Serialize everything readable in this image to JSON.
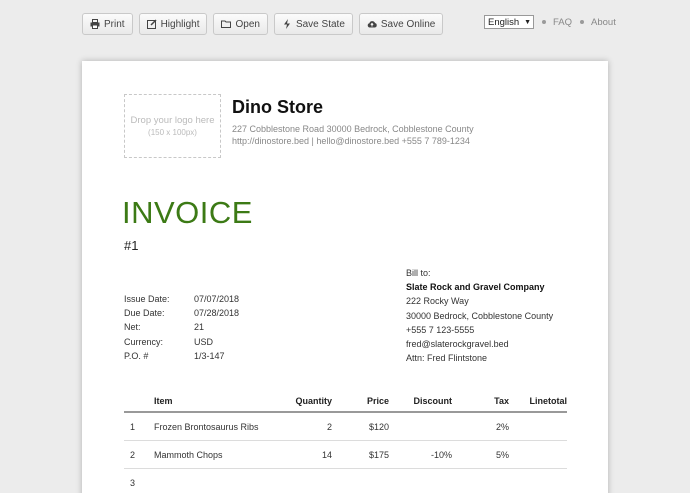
{
  "toolbar": {
    "print": "Print",
    "highlight": "Highlight",
    "open": "Open",
    "save_state": "Save State",
    "save_online": "Save Online"
  },
  "nav": {
    "language": "English",
    "faq": "FAQ",
    "about": "About"
  },
  "logo": {
    "line1": "Drop your logo here",
    "line2": "(150 x 100px)"
  },
  "store": {
    "name": "Dino Store",
    "address": "227 Cobblestone Road 30000 Bedrock, Cobblestone County",
    "contact": "http://dinostore.bed | hello@dinostore.bed +555 7 789-1234"
  },
  "invoice": {
    "title": "INVOICE",
    "number": "#1"
  },
  "meta": [
    {
      "label": "Issue Date:",
      "value": "07/07/2018"
    },
    {
      "label": "Due Date:",
      "value": "07/28/2018"
    },
    {
      "label": "Net:",
      "value": "21"
    },
    {
      "label": "Currency:",
      "value": "USD"
    },
    {
      "label": "P.O. #",
      "value": "1/3-147"
    }
  ],
  "bill_to": {
    "label": "Bill to:",
    "company": "Slate Rock and Gravel Company",
    "street": "222 Rocky Way",
    "city": "30000 Bedrock, Cobblestone County",
    "phone": "+555 7 123-5555",
    "email": "fred@slaterockgravel.bed",
    "attn": "Attn: Fred Flintstone"
  },
  "table": {
    "headers": {
      "item": "Item",
      "quantity": "Quantity",
      "price": "Price",
      "discount": "Discount",
      "tax": "Tax",
      "linetotal": "Linetotal"
    },
    "rows": [
      {
        "n": "1",
        "item": "Frozen Brontosaurus Ribs",
        "quantity": "2",
        "price": "$120",
        "discount": "",
        "tax": "2%",
        "linetotal": ""
      },
      {
        "n": "2",
        "item": "Mammoth Chops",
        "quantity": "14",
        "price": "$175",
        "discount": "-10%",
        "tax": "5%",
        "linetotal": ""
      },
      {
        "n": "3",
        "item": "",
        "quantity": "",
        "price": "",
        "discount": "",
        "tax": "",
        "linetotal": ""
      }
    ]
  },
  "icons": {
    "print": "print-icon",
    "highlight": "edit-icon",
    "open": "folder-icon",
    "save_state": "lightning-icon",
    "save_online": "cloud-upload-icon"
  },
  "colors": {
    "invoice_title": "#3c7a15"
  }
}
